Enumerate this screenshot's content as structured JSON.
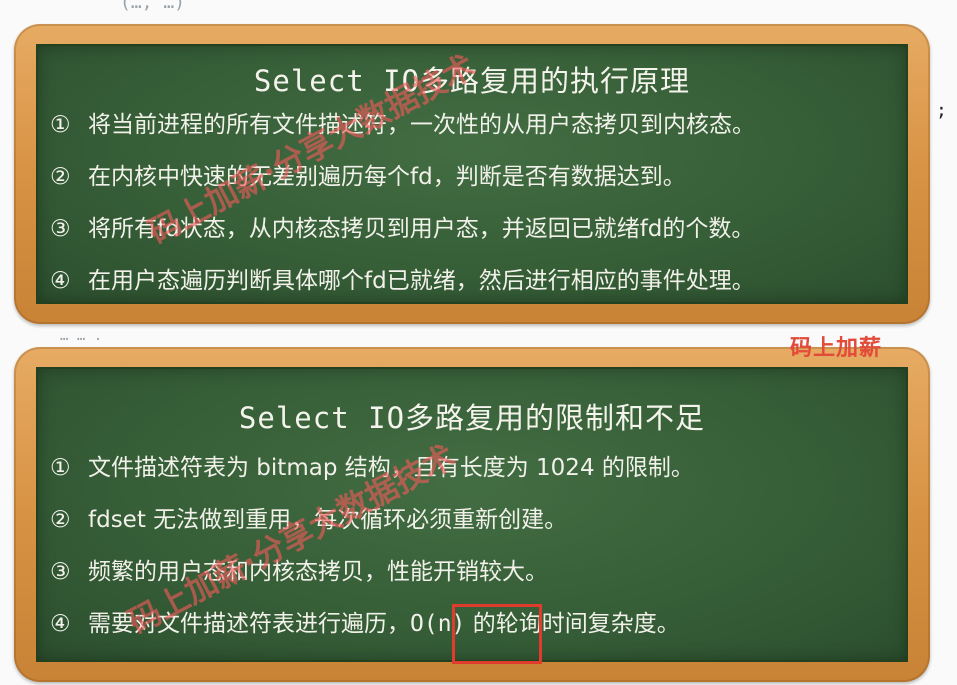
{
  "background": {
    "top_fragment": "(…, …)",
    "side_fragment": ";",
    "mid_fragment": "…  …  ."
  },
  "board1": {
    "title": "Select IO多路复用的执行原理",
    "items": [
      {
        "num": "①",
        "text": "将当前进程的所有文件描述符，一次性的从用户态拷贝到内核态。"
      },
      {
        "num": "②",
        "text": "在内核中快速的无差别遍历每个fd，判断是否有数据达到。"
      },
      {
        "num": "③",
        "text": "将所有fd状态，从内核态拷贝到用户态，并返回已就绪fd的个数。"
      },
      {
        "num": "④",
        "text": "在用户态遍历判断具体哪个fd已就绪，然后进行相应的事件处理。"
      }
    ]
  },
  "board2": {
    "title": "Select IO多路复用的限制和不足",
    "items": [
      {
        "num": "①",
        "text": "文件描述符表为 bitmap 结构，且有长度为 1024 的限制。"
      },
      {
        "num": "②",
        "text": "fdset 无法做到重用，每次循环必须重新创建。"
      },
      {
        "num": "③",
        "text": "频繁的用户态和内核态拷贝，性能开销较大。"
      },
      {
        "num": "④",
        "pre": "需要对文件描述符表进行遍历，",
        "highlight": "O(n)",
        "post": " 的轮询时间复杂度。"
      }
    ],
    "highlight_color": "#e03b2d"
  },
  "watermarks": {
    "diag_a": "码上加薪·分享大数据技术",
    "diag_b": "码上加薪·分享大数据技术",
    "corner": "码上加薪"
  },
  "colors": {
    "chalkboard": "#365e37",
    "frame": "#d89244",
    "chalk_text": "#f1f1ea",
    "watermark": "#e24a3a"
  }
}
